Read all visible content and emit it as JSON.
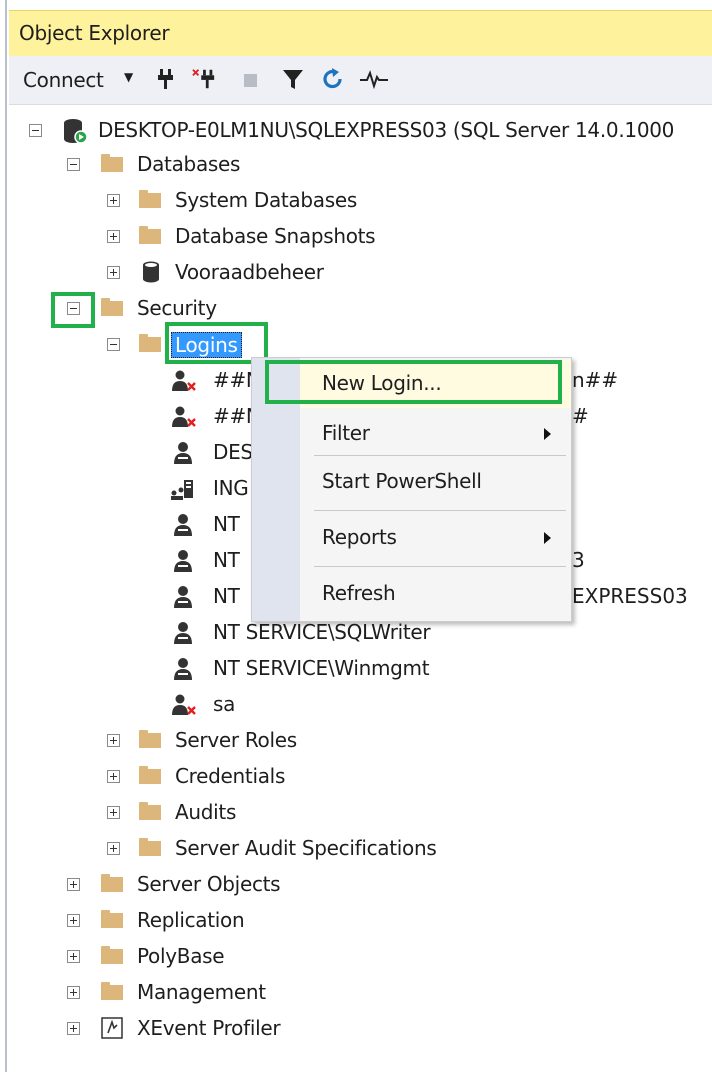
{
  "panel": {
    "title": "Object Explorer",
    "title_bg": "#fff29d"
  },
  "toolbar": {
    "connect_label": "Connect",
    "icons": [
      "connect-icon",
      "disconnect-icon",
      "stop-icon",
      "filter-icon",
      "refresh-icon",
      "activity-monitor-icon"
    ]
  },
  "tree": {
    "server": "DESKTOP-E0LM1NU\\SQLEXPRESS03 (SQL Server 14.0.1000",
    "databases": "Databases",
    "system_databases": "System Databases",
    "database_snapshots": "Database Snapshots",
    "vooraadbeheer": "Vooraadbeheer",
    "security": "Security",
    "logins": "Logins",
    "login_items": [
      "##MS_PolicyEventProcessingLogin##",
      "##MS_PolicyTsqlExecutionLogin##",
      "DESKTOP-E0LM1NU\\...",
      "INGEBOUWD\\...",
      "NT ...",
      "NT ...3",
      "NT ...EXPRESS03",
      "NT SERVICE\\SQLWriter",
      "NT SERVICE\\Winmgmt",
      "sa"
    ],
    "login_visible": {
      "l0a": "##N",
      "l0b": "n##",
      "l1a": "##N",
      "l1b": "#",
      "l2": "DES",
      "l3": "ING",
      "l4": "NT",
      "l5a": "NT",
      "l5b": "3",
      "l6a": "NT",
      "l6b": "EXPRESS03",
      "l7": "NT SERVICE\\SQLWriter",
      "l8": "NT SERVICE\\Winmgmt",
      "l9": "sa"
    },
    "server_roles": "Server Roles",
    "credentials": "Credentials",
    "audits": "Audits",
    "server_audit_specs": "Server Audit Specifications",
    "server_objects": "Server Objects",
    "replication": "Replication",
    "polybase": "PolyBase",
    "management": "Management",
    "xevent_profiler": "XEvent Profiler"
  },
  "context_menu": {
    "items": [
      "New Login...",
      "Filter",
      "Start PowerShell",
      "Reports",
      "Refresh"
    ],
    "highlighted": "New Login..."
  },
  "colors": {
    "highlight_box": "#22b04a",
    "selection": "#3399ff",
    "folder": "#dcb67a",
    "menu_gutter": "#dfe4ee"
  }
}
